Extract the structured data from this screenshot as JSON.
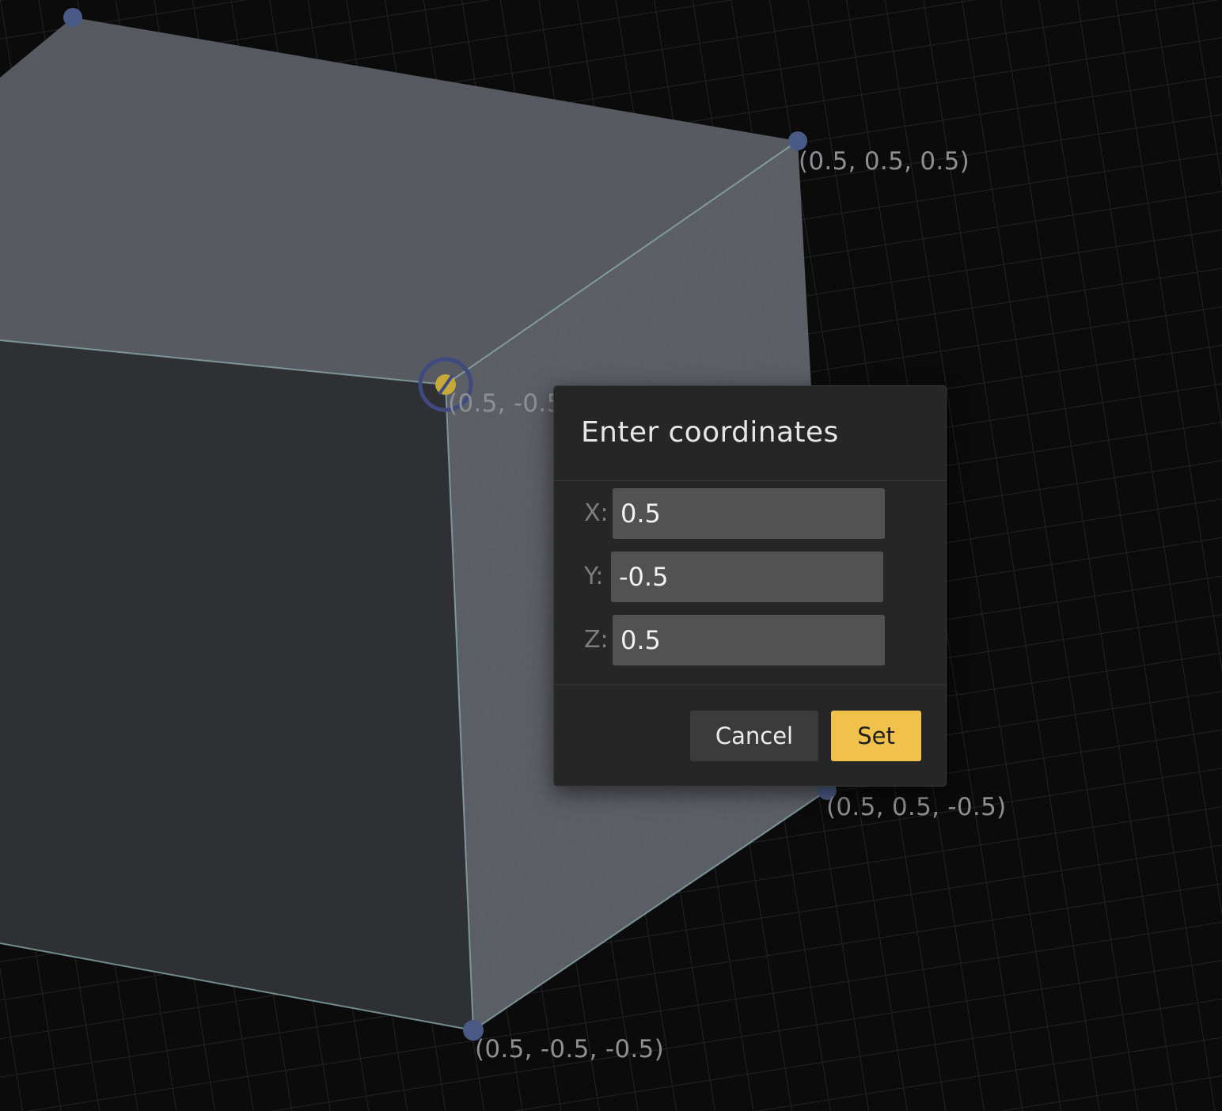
{
  "scene": {
    "vertex_labels": {
      "top_right": "(0.5, 0.5, 0.5)",
      "front": "(0.5, -0.5",
      "back_bottom": "(0.5, 0.5, -0.5)",
      "front_bottom": "(0.5, -0.5, -0.5)"
    },
    "colors": {
      "background": "#0b0b0c",
      "face_light": "#5c5f66",
      "face_dark": "#2f3034",
      "edge": "#8fb0b3",
      "vertex": "#4a5a86",
      "selected_vertex": "#c7a93a"
    }
  },
  "dialog": {
    "title": "Enter coordinates",
    "fields": {
      "x": {
        "label": "X:",
        "value": "0.5"
      },
      "y": {
        "label": "Y:",
        "value": "-0.5"
      },
      "z": {
        "label": "Z:",
        "value": "0.5"
      }
    },
    "cancel_label": "Cancel",
    "set_label": "Set",
    "accent_color": "#f0c24b"
  }
}
